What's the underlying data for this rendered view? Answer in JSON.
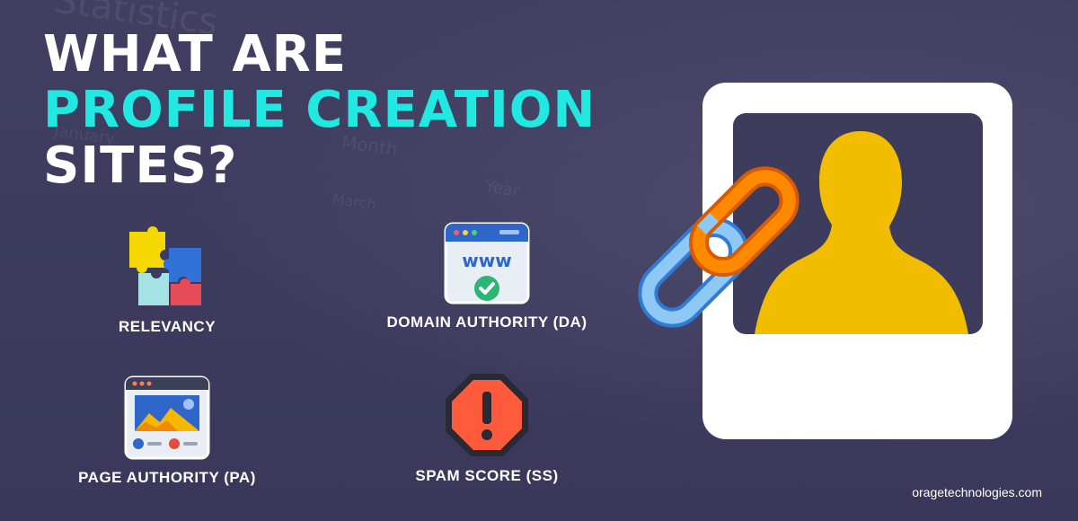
{
  "title": {
    "line1": "WHAT ARE",
    "line2": "PROFILE CREATION",
    "line3": "SITES?"
  },
  "features": [
    {
      "label": "RELEVANCY",
      "icon": "puzzle-icon"
    },
    {
      "label": "DOMAIN AUTHORITY (DA)",
      "icon": "www-check-icon"
    },
    {
      "label": "PAGE AUTHORITY (PA)",
      "icon": "webpage-image-icon"
    },
    {
      "label": "SPAM SCORE (SS)",
      "icon": "warning-stop-icon"
    }
  ],
  "footer": {
    "text": "oragetechnologies.com"
  },
  "colors": {
    "background": "#3b3a5a",
    "accent_cyan": "#22e8e2",
    "person": "#f2bc00",
    "chain_orange": "#ff8a00",
    "chain_blue": "#8ec9f5"
  }
}
